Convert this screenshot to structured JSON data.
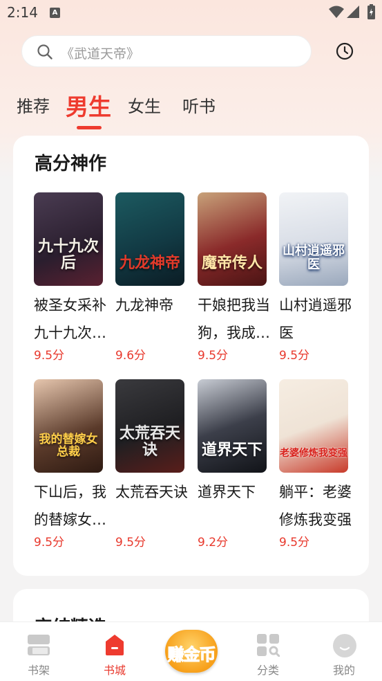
{
  "status": {
    "time": "2:14",
    "app_icon": "A"
  },
  "search": {
    "placeholder": "《武道天帝》"
  },
  "tabs": [
    {
      "label": "推荐"
    },
    {
      "label": "男生"
    },
    {
      "label": "女生"
    },
    {
      "label": "听书"
    }
  ],
  "section": {
    "title": "高分神作",
    "books": [
      {
        "title": "被圣女采补九十九次后，我成了魔帝",
        "score": "9.5分",
        "cover_text": "九十九次后",
        "cover_color": "#2a1e2e"
      },
      {
        "title": "九龙神帝",
        "score": "9.6分",
        "cover_text": "九龙神帝",
        "cover_color": "#123a44"
      },
      {
        "title": "干娘把我当狗，我成魔帝传人",
        "score": "9.5分",
        "cover_text": "魔帝传人",
        "cover_color": "#8a2a2a"
      },
      {
        "title": "山村逍遥邪医",
        "score": "9.5分",
        "cover_text": "山村逍遥邪医",
        "cover_color": "#d8dde6"
      },
      {
        "title": "下山后，我的替嫁女总裁",
        "score": "9.5分",
        "cover_text": "我的替嫁女总裁",
        "cover_color": "#5a3a2a"
      },
      {
        "title": "太荒吞天诀",
        "score": "9.5分",
        "cover_text": "太荒吞天诀",
        "cover_color": "#1f1f22"
      },
      {
        "title": "道界天下",
        "score": "9.2分",
        "cover_text": "道界天下",
        "cover_color": "#3c3f4a"
      },
      {
        "title": "躺平：老婆修炼我变强",
        "score": "9.5分",
        "cover_text": "老婆修炼我变强",
        "cover_color": "#efe3d6"
      }
    ]
  },
  "section2": {
    "title": "完结精选"
  },
  "nav": {
    "items": [
      {
        "label": "书架",
        "icon": "bookshelf-icon"
      },
      {
        "label": "书城",
        "icon": "bookstore-icon"
      },
      {
        "label": "分类",
        "icon": "category-icon"
      },
      {
        "label": "我的",
        "icon": "profile-icon"
      }
    ],
    "earn_label": "赚金币"
  },
  "colors": {
    "accent": "#ee3b2f",
    "score": "#e8382c"
  }
}
